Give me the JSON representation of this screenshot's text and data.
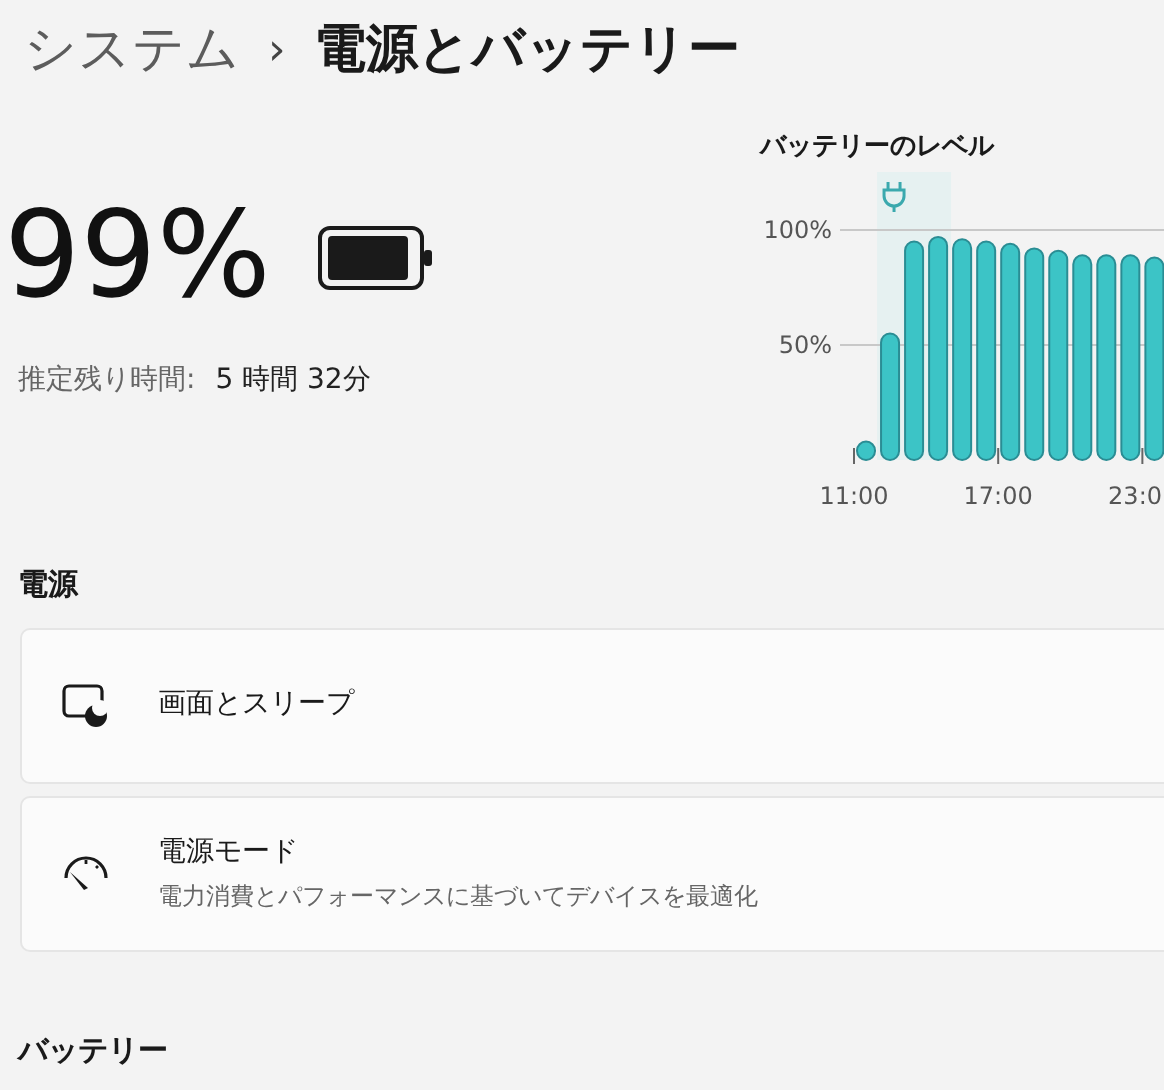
{
  "breadcrumb": {
    "parent": "システム",
    "separator": "›",
    "current": "電源とバッテリー"
  },
  "battery": {
    "percent": "99%",
    "estimate_label": "推定残り時間:",
    "estimate_value": "5 時間 32分"
  },
  "chart": {
    "charging_marker": true,
    "chart_data": {
      "type": "bar",
      "title": "バッテリーのレベル",
      "x": [
        11.5,
        12.5,
        13.5,
        14.5,
        15.5,
        16.5,
        17.5,
        18.5,
        19.5,
        20.5,
        21.5,
        22.5,
        23.5
      ],
      "series": [
        {
          "color": "#3cc4c6",
          "values": [
            8,
            55,
            95,
            97,
            96,
            95,
            94,
            92,
            91,
            89,
            89,
            89,
            88
          ]
        }
      ],
      "xlim": [
        11,
        23.9
      ],
      "ylim": [
        0,
        100
      ],
      "yticks": [
        {
          "value": 50,
          "label": "50%"
        },
        {
          "value": 100,
          "label": "100%"
        }
      ],
      "xticks": [
        {
          "value": 11,
          "label": "11:00"
        },
        {
          "value": 17,
          "label": "17:00"
        },
        {
          "value": 23,
          "label": "23:0"
        }
      ]
    }
  },
  "power_section": {
    "heading": "電源",
    "items": [
      {
        "kind": "sleep",
        "title": "画面とスリープ"
      },
      {
        "kind": "power-mode",
        "title": "電源モード",
        "subtitle": "電力消費とパフォーマンスに基づいてデバイスを最適化"
      }
    ]
  },
  "battery_section": {
    "heading": "バッテリー"
  }
}
